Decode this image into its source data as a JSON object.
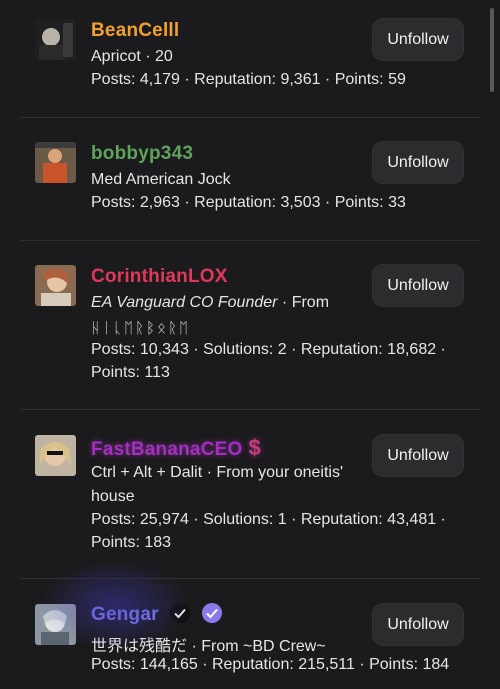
{
  "unfollow_label": "Unfollow",
  "users": [
    {
      "username": "BeanCelll",
      "name_color": "#f0a030",
      "subtitle": "Apricot · 20",
      "stats": "Posts: 4,179 · Reputation: 9,361 · Points: 59"
    },
    {
      "username": "bobbyp343",
      "name_color": "#5fa35a",
      "subtitle": "Med American Jock",
      "stats": "Posts: 2,963 · Reputation: 3,503 · Points: 33"
    },
    {
      "username": "CorinthianLOX",
      "name_color": "#e0385d",
      "subtitle_italic": "EA Vanguard CO Founder",
      "subtitle_rest": " · From",
      "subtitle_line2": "ᚺᛁᚳᛖᚱᛒᛟᚱᛖ",
      "stats": "Posts: 10,343 · Solutions: 2 · Reputation: 18,682 · Points: 113"
    },
    {
      "username": "FastBananaCEO",
      "name_color": "#a12fbf",
      "badge": "$",
      "subtitle": "Ctrl + Alt + Dalit · From your oneitis'",
      "subtitle_line2": "house",
      "stats": "Posts: 25,974 · Solutions: 1 · Reputation: 43,481 · Points: 183"
    },
    {
      "username": "Gengar",
      "name_color": "#7a78e8",
      "subtitle": "世界は残酷だ · From ~BD Crew~",
      "stats": "Posts: 144,165 · Reputation: 215,511 · Points: 184"
    }
  ]
}
